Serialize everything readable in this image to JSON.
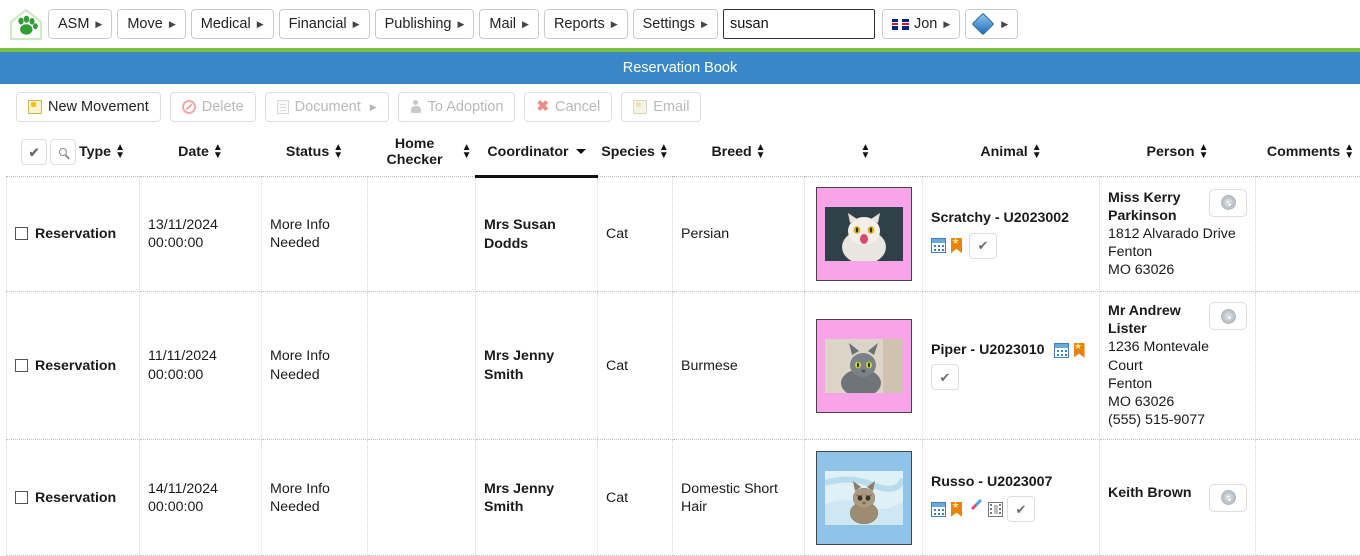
{
  "app": {
    "logo_icon": "paw-house-logo",
    "accent_blue": "#3a87c8",
    "accent_green": "#7bc043"
  },
  "topnav": {
    "menus": [
      {
        "label": "ASM"
      },
      {
        "label": "Move"
      },
      {
        "label": "Medical"
      },
      {
        "label": "Financial"
      },
      {
        "label": "Publishing"
      },
      {
        "label": "Mail"
      },
      {
        "label": "Reports"
      },
      {
        "label": "Settings"
      }
    ],
    "search": {
      "value": "susan",
      "placeholder": ""
    },
    "user": {
      "label": "Jon",
      "flag_icon": "uk-flag-icon"
    },
    "theme_button": {
      "icon": "gem-icon"
    }
  },
  "titlebar": {
    "title": "Reservation Book"
  },
  "toolbar": {
    "buttons": [
      {
        "label": "New Movement",
        "icon": "new-movement-icon",
        "disabled": false,
        "has_caret": false
      },
      {
        "label": "Delete",
        "icon": "delete-icon",
        "disabled": true,
        "has_caret": false
      },
      {
        "label": "Document",
        "icon": "document-icon",
        "disabled": true,
        "has_caret": true
      },
      {
        "label": "To Adoption",
        "icon": "person-icon",
        "disabled": true,
        "has_caret": false
      },
      {
        "label": "Cancel",
        "icon": "x-icon",
        "disabled": true,
        "has_caret": false
      },
      {
        "label": "Email",
        "icon": "email-icon",
        "disabled": true,
        "has_caret": false
      }
    ]
  },
  "table": {
    "select_all_button": {
      "icon": "check-icon"
    },
    "filter_button": {
      "icon": "magnifier-icon"
    },
    "columns": [
      {
        "label": "Type",
        "sorted": false
      },
      {
        "label": "Date",
        "sorted": false
      },
      {
        "label": "Status",
        "sorted": false
      },
      {
        "label": "Home Checker",
        "sorted": false
      },
      {
        "label": "Coordinator",
        "sorted": true
      },
      {
        "label": "Species",
        "sorted": false
      },
      {
        "label": "Breed",
        "sorted": false
      },
      {
        "label": "",
        "sorted": false
      },
      {
        "label": "Animal",
        "sorted": false
      },
      {
        "label": "Person",
        "sorted": false
      },
      {
        "label": "Comments",
        "sorted": false
      }
    ],
    "rows": [
      {
        "type": "Reservation",
        "date": "13/11/2024 00:00:00",
        "status": "More Info Needed",
        "home_checker": "",
        "coordinator": "Mrs Susan Dodds",
        "species": "Cat",
        "breed": "Persian",
        "photo": {
          "sex": "female",
          "subject": "white-persian-cat"
        },
        "animal": {
          "name": "Scratchy - U2023002",
          "icons": [
            "calendar-icon",
            "bookmark-star-icon"
          ],
          "icons_inline": false,
          "check_button": true
        },
        "person": {
          "name": "Miss Kerry Parkinson",
          "address": [
            "1812 Alvarado Drive",
            "Fenton",
            "MO 63026"
          ],
          "phone": "",
          "media_button": "cd-icon"
        },
        "comments": ""
      },
      {
        "type": "Reservation",
        "date": "11/11/2024 00:00:00",
        "status": "More Info Needed",
        "home_checker": "",
        "coordinator": "Mrs Jenny Smith",
        "species": "Cat",
        "breed": "Burmese",
        "photo": {
          "sex": "female",
          "subject": "grey-burmese-cat"
        },
        "animal": {
          "name": "Piper - U2023010",
          "icons": [
            "calendar-icon",
            "bookmark-star-icon"
          ],
          "icons_inline": true,
          "check_button": true
        },
        "person": {
          "name": "Mr Andrew Lister",
          "address": [
            "1236 Montevale Court",
            "Fenton",
            "MO 63026"
          ],
          "phone": "(555) 515-9077",
          "media_button": "cd-icon"
        },
        "comments": ""
      },
      {
        "type": "Reservation",
        "date": "14/11/2024 00:00:00",
        "status": "More Info Needed",
        "home_checker": "",
        "coordinator": "Mrs Jenny Smith",
        "species": "Cat",
        "breed": "Domestic Short Hair",
        "photo": {
          "sex": "male",
          "subject": "tabby-kitten-blue-blanket"
        },
        "animal": {
          "name": "Russo - U2023007",
          "icons": [
            "calendar-icon",
            "bookmark-star-icon",
            "pen-icon",
            "film-icon"
          ],
          "icons_inline": false,
          "check_button": true
        },
        "person": {
          "name": "Keith Brown",
          "address": [],
          "phone": "",
          "media_button": "cd-icon"
        },
        "comments": ""
      }
    ]
  }
}
